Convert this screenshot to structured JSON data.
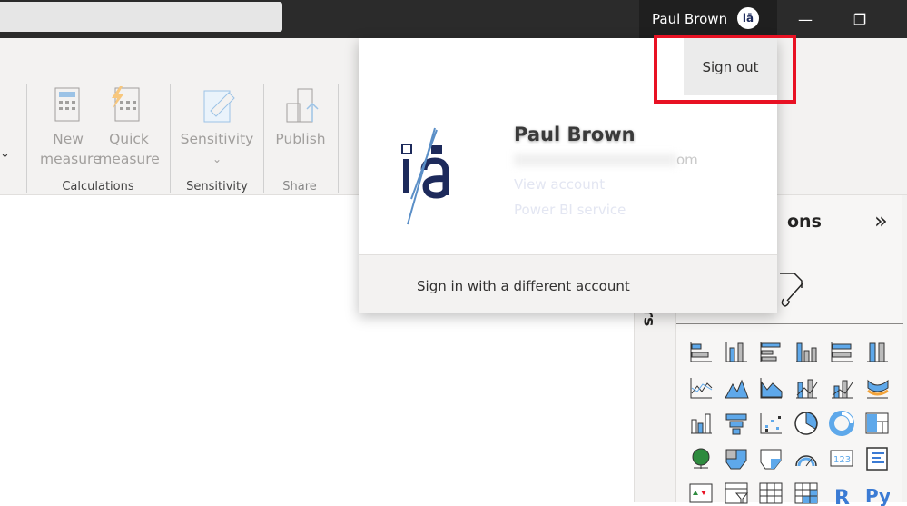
{
  "titlebar": {
    "user_name": "Paul Brown",
    "avatar_text": "iā",
    "minimize_icon": "minimize-icon",
    "restore_icon": "restore-icon"
  },
  "ribbon": {
    "buttons": [
      {
        "label1": "New",
        "label2": "measure"
      },
      {
        "label1": "Quick",
        "label2": "measure"
      },
      {
        "label1": "Sensitivity",
        "label2": "⌄"
      },
      {
        "label1": "Publish",
        "label2": ""
      }
    ],
    "groups": [
      "Calculations",
      "Sensitivity",
      "Share"
    ]
  },
  "account_popup": {
    "name": "Paul Brown",
    "email_suffix": "om",
    "view_account": "View account",
    "power_bi_service": "Power BI service",
    "sign_out": "Sign out",
    "sign_in_different": "Sign in with a different account",
    "logo_text": "iā"
  },
  "visualizations": {
    "title_partial": "ons",
    "collapse_icon": "»",
    "side_label_partial": "rs"
  },
  "colors": {
    "highlight": "#e81123",
    "accent": "#118dff",
    "titlebar": "#2b2b2b"
  }
}
